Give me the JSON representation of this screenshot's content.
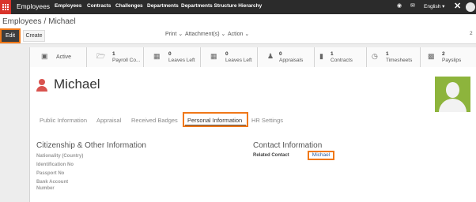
{
  "navbar": {
    "brand": "Employees",
    "menu": [
      "Employees",
      "Contracts",
      "Challenges",
      "Departments",
      "Departments Structure Hierarchy"
    ],
    "language": "English",
    "accent_color": "#d9342b"
  },
  "control": {
    "breadcrumb_parent": "Employees",
    "breadcrumb_sep": "/",
    "breadcrumb_current": "Michael",
    "edit_label": "Edit",
    "create_label": "Create",
    "print_label": "Print",
    "attachments_label": "Attachment(s)",
    "action_label": "Action",
    "pager": "2"
  },
  "smart_buttons": [
    {
      "icon": "archive-icon",
      "label": "Active"
    },
    {
      "icon": "folder-icon",
      "count": "1",
      "label": "Payroll Co..."
    },
    {
      "icon": "calendar-icon",
      "count": "0",
      "label": "Leaves Left"
    },
    {
      "icon": "calendar-icon",
      "count": "0",
      "label": "Leaves Left"
    },
    {
      "icon": "users-icon",
      "count": "0",
      "label": "Appraisals"
    },
    {
      "icon": "book-icon",
      "count": "1",
      "label": "Contracts"
    },
    {
      "icon": "clock-icon",
      "count": "1",
      "label": "Timesheets"
    },
    {
      "icon": "money-icon",
      "count": "2",
      "label": "Payslips"
    }
  ],
  "employee": {
    "name": "Michael"
  },
  "tabs": [
    "Public Information",
    "Appraisal",
    "Received Badges",
    "Personal Information",
    "HR Settings"
  ],
  "active_tab": "Personal Information",
  "citizenship": {
    "title": "Citizenship & Other Information",
    "fields": [
      "Nationality (Country)",
      "Identification No",
      "Passport No",
      "Bank Account",
      "Number"
    ]
  },
  "contact": {
    "title": "Contact Information",
    "related_label": "Related Contact",
    "related_value": "Michael"
  }
}
